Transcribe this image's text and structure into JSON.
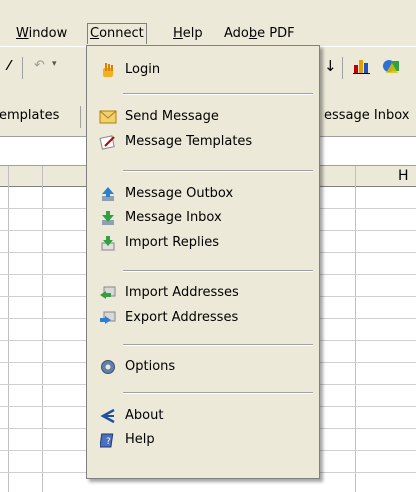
{
  "menubar": {
    "items": [
      {
        "label": "Window",
        "u": "W",
        "rest": "indow"
      },
      {
        "label": "Connect",
        "u": "C",
        "rest": "onnect"
      },
      {
        "label": "Help",
        "u": "H",
        "rest": "elp"
      },
      {
        "label": "Adobe PDF",
        "pre": "Ado",
        "u": "b",
        "rest": "e PDF"
      }
    ]
  },
  "toolbar2": {
    "left_text": "emplates",
    "right_text": "essage Inbox"
  },
  "grid": {
    "col_header": "H"
  },
  "connect_menu": {
    "items": [
      {
        "label": "Login",
        "icon": "login-icon"
      },
      {
        "label": "Send Message",
        "icon": "envelope-icon"
      },
      {
        "label": "Message Templates",
        "icon": "templates-icon"
      },
      {
        "label": "Message Outbox",
        "icon": "outbox-icon"
      },
      {
        "label": "Message Inbox",
        "icon": "inbox-icon"
      },
      {
        "label": "Import Replies",
        "icon": "import-replies-icon"
      },
      {
        "label": "Import Addresses",
        "icon": "import-addresses-icon"
      },
      {
        "label": "Export Addresses",
        "icon": "export-addresses-icon"
      },
      {
        "label": "Options",
        "icon": "gear-icon"
      },
      {
        "label": "About",
        "icon": "about-icon"
      },
      {
        "label": "Help",
        "icon": "help-book-icon"
      }
    ]
  }
}
